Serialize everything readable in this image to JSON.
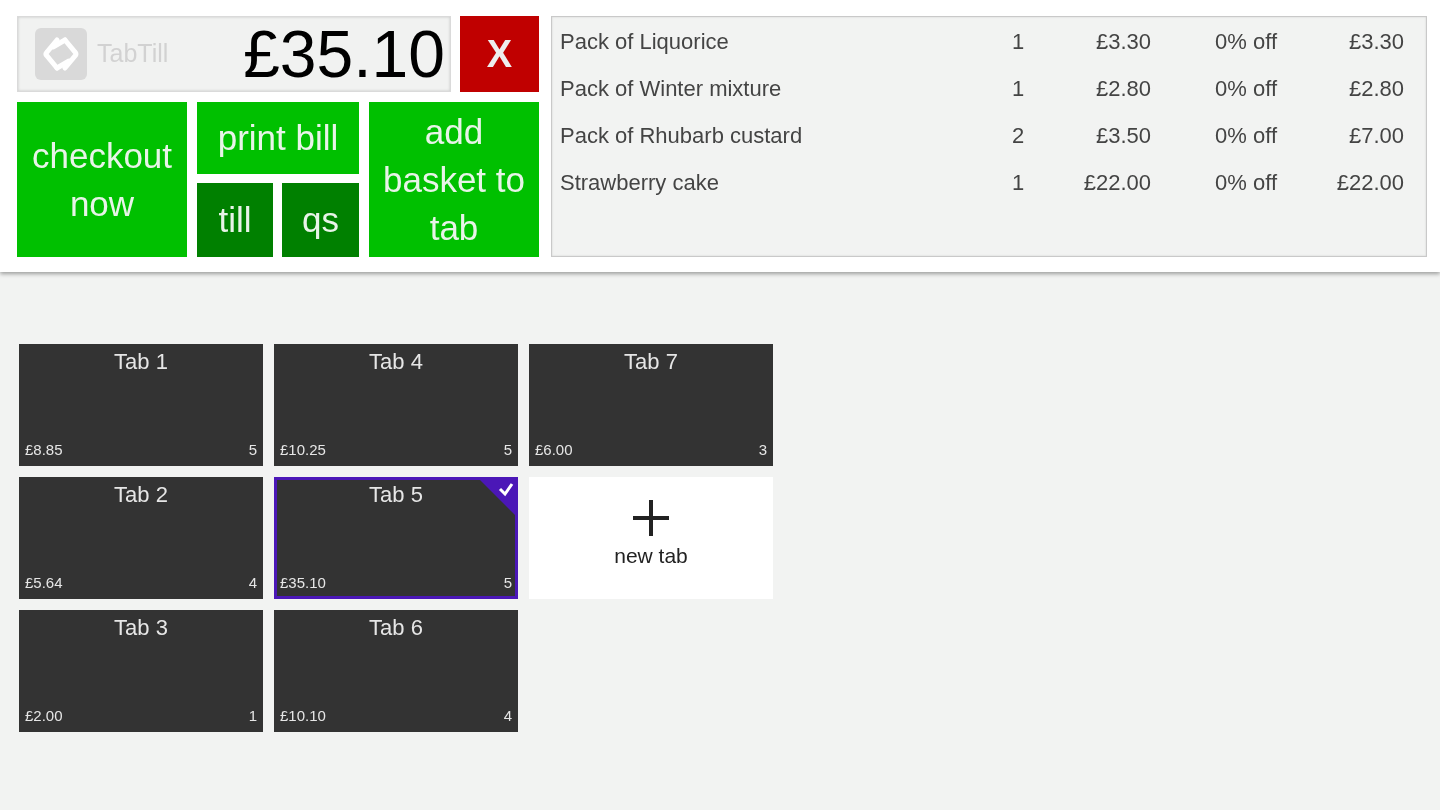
{
  "header": {
    "logo_text": "TabTill",
    "total": "£35.10",
    "close_button": "X"
  },
  "actions": {
    "checkout": "checkout now",
    "print_bill": "print bill",
    "till": "till",
    "qs": "qs",
    "add_to_tab": "add basket to tab"
  },
  "basket": {
    "rows": [
      {
        "item": "Pack of Liquorice",
        "quantity": "1",
        "price": "£3.30",
        "discount": "0% off",
        "total": "£3.30"
      },
      {
        "item": "Pack of Winter mixture",
        "quantity": "1",
        "price": "£2.80",
        "discount": "0% off",
        "total": "£2.80"
      },
      {
        "item": "Pack of Rhubarb custard",
        "quantity": "2",
        "price": "£3.50",
        "discount": "0% off",
        "total": "£7.00"
      },
      {
        "item": "Strawberry cake",
        "quantity": "1",
        "price": "£22.00",
        "discount": "0% off",
        "total": "£22.00"
      }
    ]
  },
  "tabs": [
    {
      "name": "Tab 1",
      "amount": "£8.85",
      "count": "5",
      "selected": false
    },
    {
      "name": "Tab 2",
      "amount": "£5.64",
      "count": "4",
      "selected": false
    },
    {
      "name": "Tab 3",
      "amount": "£2.00",
      "count": "1",
      "selected": false
    },
    {
      "name": "Tab 4",
      "amount": "£10.25",
      "count": "5",
      "selected": false
    },
    {
      "name": "Tab 5",
      "amount": "£35.10",
      "count": "5",
      "selected": true
    },
    {
      "name": "Tab 6",
      "amount": "£10.10",
      "count": "4",
      "selected": false
    },
    {
      "name": "Tab 7",
      "amount": "£6.00",
      "count": "3",
      "selected": false
    }
  ],
  "new_tab": {
    "label": "new tab"
  }
}
